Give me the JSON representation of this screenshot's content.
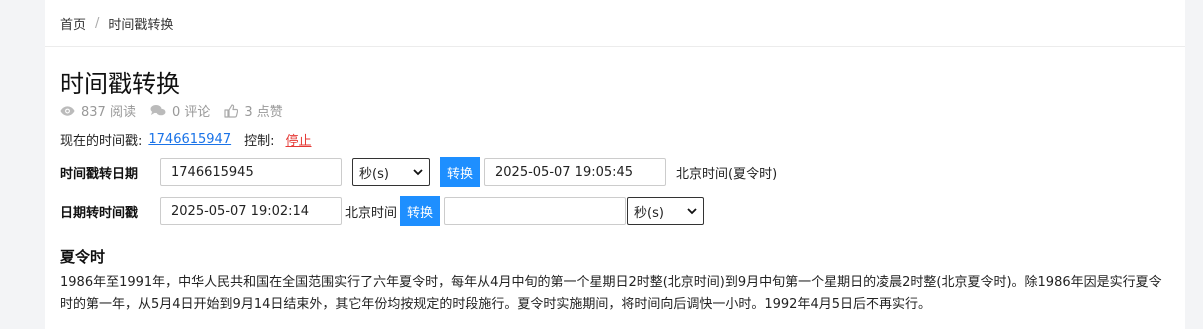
{
  "breadcrumb": {
    "home": "首页",
    "separator": "/",
    "current": "时间戳转换"
  },
  "page": {
    "title": "时间戳转换",
    "views": "837 阅读",
    "comments": "0 评论",
    "likes": "3 点赞"
  },
  "now": {
    "label": "现在的时间戳:",
    "timestamp": "1746615947",
    "control_label": "控制:",
    "stop": "停止"
  },
  "ts_to_date": {
    "label": "时间戳转日期",
    "input_value": "1746615945",
    "unit": "秒(s)",
    "button": "转换",
    "result": "2025-05-07 19:05:45",
    "zone": "北京时间(夏令时)"
  },
  "date_to_ts": {
    "label": "日期转时间戳",
    "input_value": "2025-05-07 19:02:14",
    "zone": "北京时间",
    "button": "转换",
    "result": "",
    "unit": "秒(s)"
  },
  "dst": {
    "title": "夏令时",
    "body": "1986年至1991年，中华人民共和国在全国范围实行了六年夏令时，每年从4月中旬的第一个星期日2时整(北京时间)到9月中旬第一个星期日的凌晨2时整(北京夏令时)。除1986年因是实行夏令时的第一年，从5月4日开始到9月14日结束外，其它年份均按规定的时段施行。夏令时实施期间，将时间向后调快一小时。1992年4月5日后不再实行。"
  }
}
